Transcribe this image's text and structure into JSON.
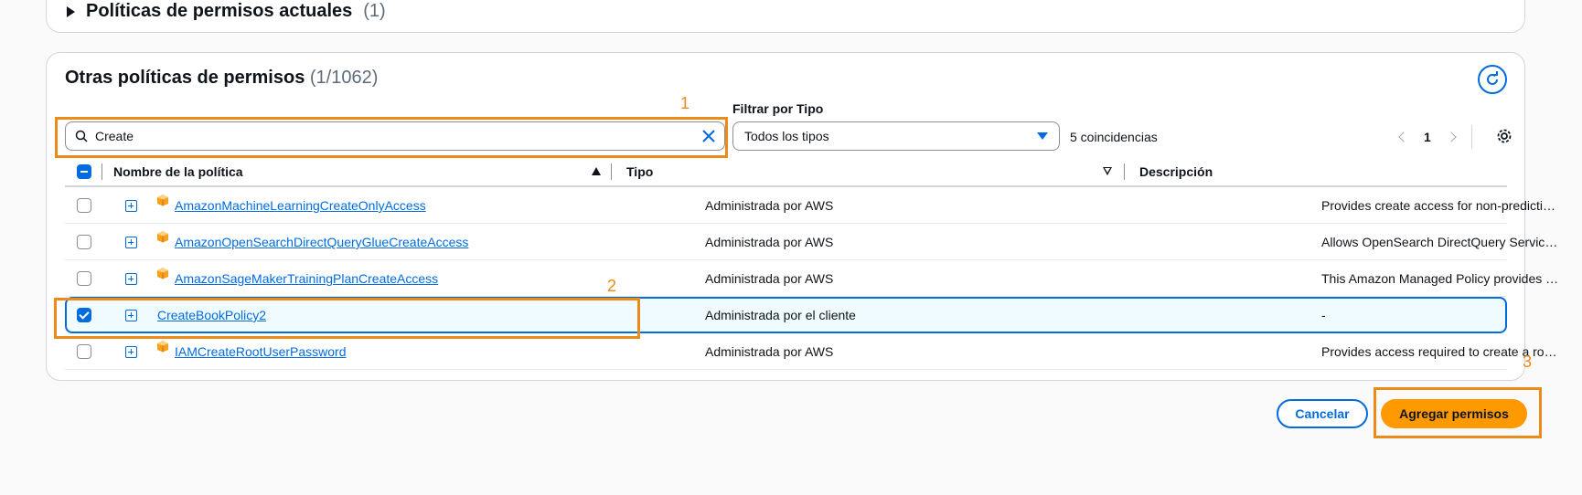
{
  "current_policies": {
    "label": "Políticas de permisos actuales",
    "count": "(1)"
  },
  "other_policies": {
    "title": "Otras políticas de permisos",
    "count": "(1/1062)"
  },
  "search": {
    "value": "Create"
  },
  "filter": {
    "label": "Filtrar por Tipo",
    "selected": "Todos los tipos"
  },
  "matches": "5 coincidencias",
  "pagination": {
    "page": "1"
  },
  "columns": {
    "name": "Nombre de la política",
    "type": "Tipo",
    "description": "Descripción"
  },
  "rows": [
    {
      "name": "AmazonMachineLearningCreateOnlyAccess",
      "type": "Administrada por AWS",
      "description": "Provides create access for non-predictive operations",
      "checked": false,
      "aws_logo": true
    },
    {
      "name": "AmazonOpenSearchDirectQueryGlueCreateAccess",
      "type": "Administrada por AWS",
      "description": "Allows OpenSearch DirectQuery Service access",
      "checked": false,
      "aws_logo": true
    },
    {
      "name": "AmazonSageMakerTrainingPlanCreateAccess",
      "type": "Administrada por AWS",
      "description": "This Amazon Managed Policy provides access",
      "checked": false,
      "aws_logo": true
    },
    {
      "name": "CreateBookPolicy2",
      "type": "Administrada por el cliente",
      "description": "-",
      "checked": true,
      "aws_logo": false
    },
    {
      "name": "IAMCreateRootUserPassword",
      "type": "Administrada por AWS",
      "description": "Provides access required to create a root user password",
      "checked": false,
      "aws_logo": true
    }
  ],
  "buttons": {
    "cancel": "Cancelar",
    "add": "Agregar permisos"
  },
  "annotations": [
    "1",
    "2",
    "3"
  ],
  "colors": {
    "accent": "#006ce0",
    "primary_button": "#ff9900",
    "annotation": "#ec8a1a"
  }
}
